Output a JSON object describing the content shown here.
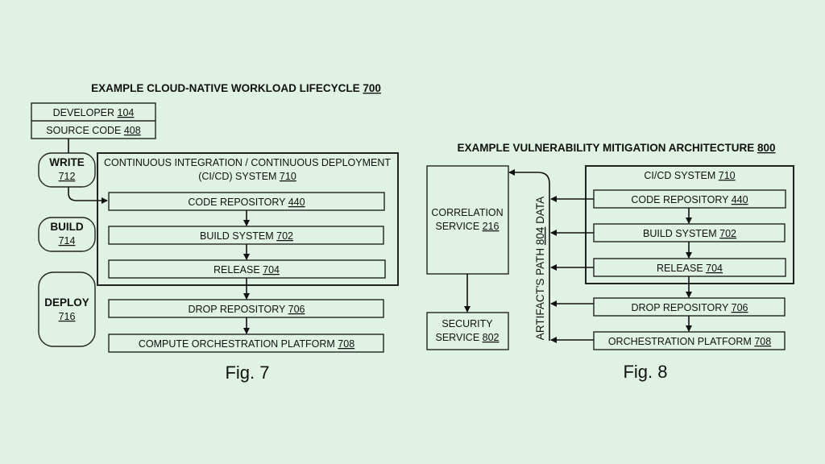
{
  "fig7": {
    "title": {
      "text": "EXAMPLE CLOUD-NATIVE WORKLOAD LIFECYCLE ",
      "num": "700"
    },
    "developer": {
      "text": "DEVELOPER ",
      "num": "104"
    },
    "source_code": {
      "text": "SOURCE CODE ",
      "num": "408"
    },
    "phases": [
      {
        "label": "WRITE",
        "num": "712"
      },
      {
        "label": "BUILD",
        "num": "714"
      },
      {
        "label": "DEPLOY",
        "num": "716"
      }
    ],
    "cicd": {
      "line1": "CONTINUOUS INTEGRATION / CONTINUOUS DEPLOYMENT",
      "line2": "(CI/CD) SYSTEM ",
      "num": "710"
    },
    "stages": [
      {
        "text": "CODE REPOSITORY ",
        "num": "440"
      },
      {
        "text": "BUILD SYSTEM ",
        "num": "702"
      },
      {
        "text": "RELEASE ",
        "num": "704"
      },
      {
        "text": "DROP REPOSITORY ",
        "num": "706"
      },
      {
        "text": "COMPUTE ORCHESTRATION PLATFORM ",
        "num": "708"
      }
    ],
    "caption": "Fig. 7"
  },
  "fig8": {
    "title": {
      "text": "EXAMPLE VULNERABILITY MITIGATION ARCHITECTURE ",
      "num": "800"
    },
    "correlation": {
      "line1": "CORRELATION",
      "line2": "SERVICE ",
      "num": "216"
    },
    "security": {
      "line1": "SECURITY",
      "line2": "SERVICE ",
      "num": "802"
    },
    "path_label": {
      "pre": "ARTIFACT'S PATH ",
      "num": "804",
      "post": " DATA"
    },
    "cicd": {
      "text": "CI/CD SYSTEM ",
      "num": "710"
    },
    "stages": [
      {
        "text": "CODE REPOSITORY ",
        "num": "440"
      },
      {
        "text": "BUILD SYSTEM ",
        "num": "702"
      },
      {
        "text": "RELEASE ",
        "num": "704"
      },
      {
        "text": "DROP REPOSITORY ",
        "num": "706"
      },
      {
        "text": "ORCHESTRATION PLATFORM ",
        "num": "708"
      }
    ],
    "caption": "Fig. 8"
  }
}
